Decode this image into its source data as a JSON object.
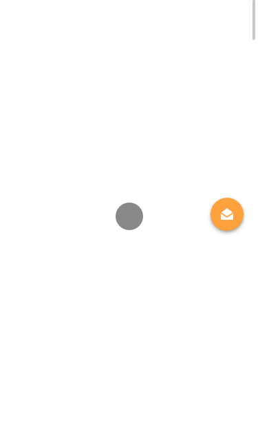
{
  "colors": {
    "background": "#ffffff",
    "spinner": "#888888",
    "fab_background": "#ffa23e",
    "fab_icon": "#ffffff",
    "scrollbar_thumb": "#c8c8c8"
  },
  "spinner": {
    "icon": "loading-spinner"
  },
  "fab": {
    "icon": "mail-open-icon"
  }
}
